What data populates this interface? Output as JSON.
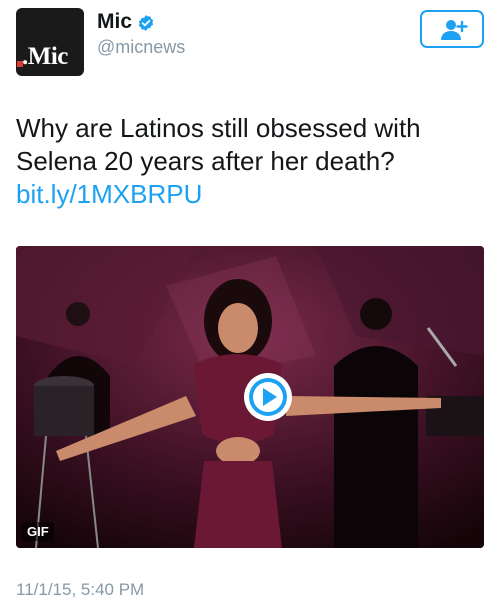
{
  "author": {
    "avatar_text": ".Mic",
    "display_name": "Mic",
    "handle": "@micnews",
    "verified": true
  },
  "follow_button": {
    "icon": "add-user-icon"
  },
  "tweet": {
    "text": "Why are Latinos still obsessed with Selena 20 years after her death? ",
    "link_text": "bit.ly/1MXBRPU"
  },
  "media": {
    "type_badge": "GIF",
    "play_icon": "play-icon"
  },
  "timestamp": "11/1/15, 5:40 PM",
  "colors": {
    "accent": "#1da1f2",
    "secondary_text": "#8899a6",
    "primary_text": "#14171a",
    "avatar_bg": "#1a1a1a"
  }
}
